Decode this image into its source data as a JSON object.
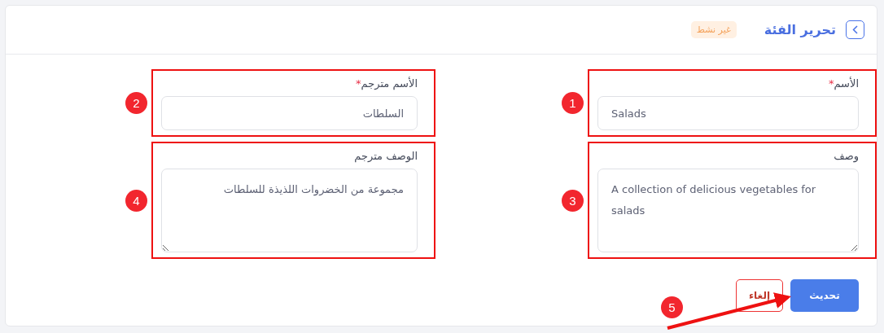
{
  "header": {
    "title": "تحرير الفئة",
    "status_badge": "غير نشط"
  },
  "columns": [
    {
      "fields": [
        {
          "kind": "input",
          "label": "الأسم",
          "required_mark": "*",
          "value": "Salads",
          "annotation": "1"
        },
        {
          "kind": "textarea",
          "label": "وصف",
          "value": "A collection of delicious vegetables for salads",
          "annotation": "3"
        }
      ]
    },
    {
      "fields": [
        {
          "kind": "input",
          "label": "الأسم مترجم",
          "required_mark": "*",
          "value": "السلطات",
          "annotation": "2"
        },
        {
          "kind": "textarea",
          "label": "الوصف مترجم",
          "value": "مجموعة من الخضروات اللذيذة للسلطات",
          "annotation": "4"
        }
      ]
    }
  ],
  "buttons": [
    {
      "kind": "primary",
      "label": "تحديث"
    },
    {
      "kind": "outline",
      "label": "إلغاء"
    }
  ],
  "arrow_annotation": "5"
}
